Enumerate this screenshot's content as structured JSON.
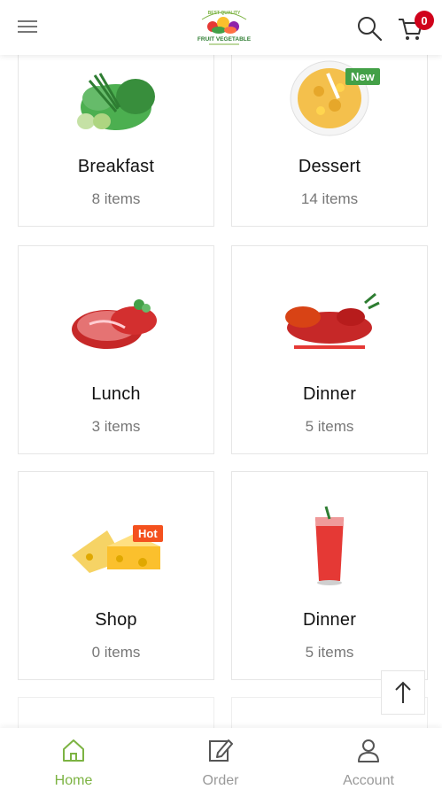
{
  "header": {
    "menu_icon": "hamburger-icon",
    "logo_top_text": "BEST QUALITY",
    "logo_text": "FRUIT VEGETABLE",
    "search_icon": "search-icon",
    "cart_icon": "cart-icon",
    "cart_count": "0"
  },
  "categories": [
    {
      "name": "Breakfast",
      "count": "8 items",
      "image": "herbs-vegetables",
      "tag": ""
    },
    {
      "name": "Dessert",
      "count": "14 items",
      "image": "cornflakes-bowl",
      "tag": "New"
    },
    {
      "name": "Lunch",
      "count": "3 items",
      "image": "raw-meat",
      "tag": ""
    },
    {
      "name": "Dinner",
      "count": "5 items",
      "image": "lobster",
      "tag": ""
    },
    {
      "name": "Shop",
      "count": "0 items",
      "image": "cheese",
      "tag": "Hot"
    },
    {
      "name": "Dinner",
      "count": "5 items",
      "image": "red-drink",
      "tag": ""
    }
  ],
  "tag_colors": {
    "New": "#43a047",
    "Hot": "#f4511e"
  },
  "back_to_top_icon": "arrow-up-icon",
  "bottom_nav": [
    {
      "label": "Home",
      "icon": "home-icon",
      "active": true
    },
    {
      "label": "Order",
      "icon": "edit-icon",
      "active": false
    },
    {
      "label": "Account",
      "icon": "user-icon",
      "active": false
    }
  ],
  "colors": {
    "accent": "#7cb342",
    "badge": "#d0021b"
  }
}
